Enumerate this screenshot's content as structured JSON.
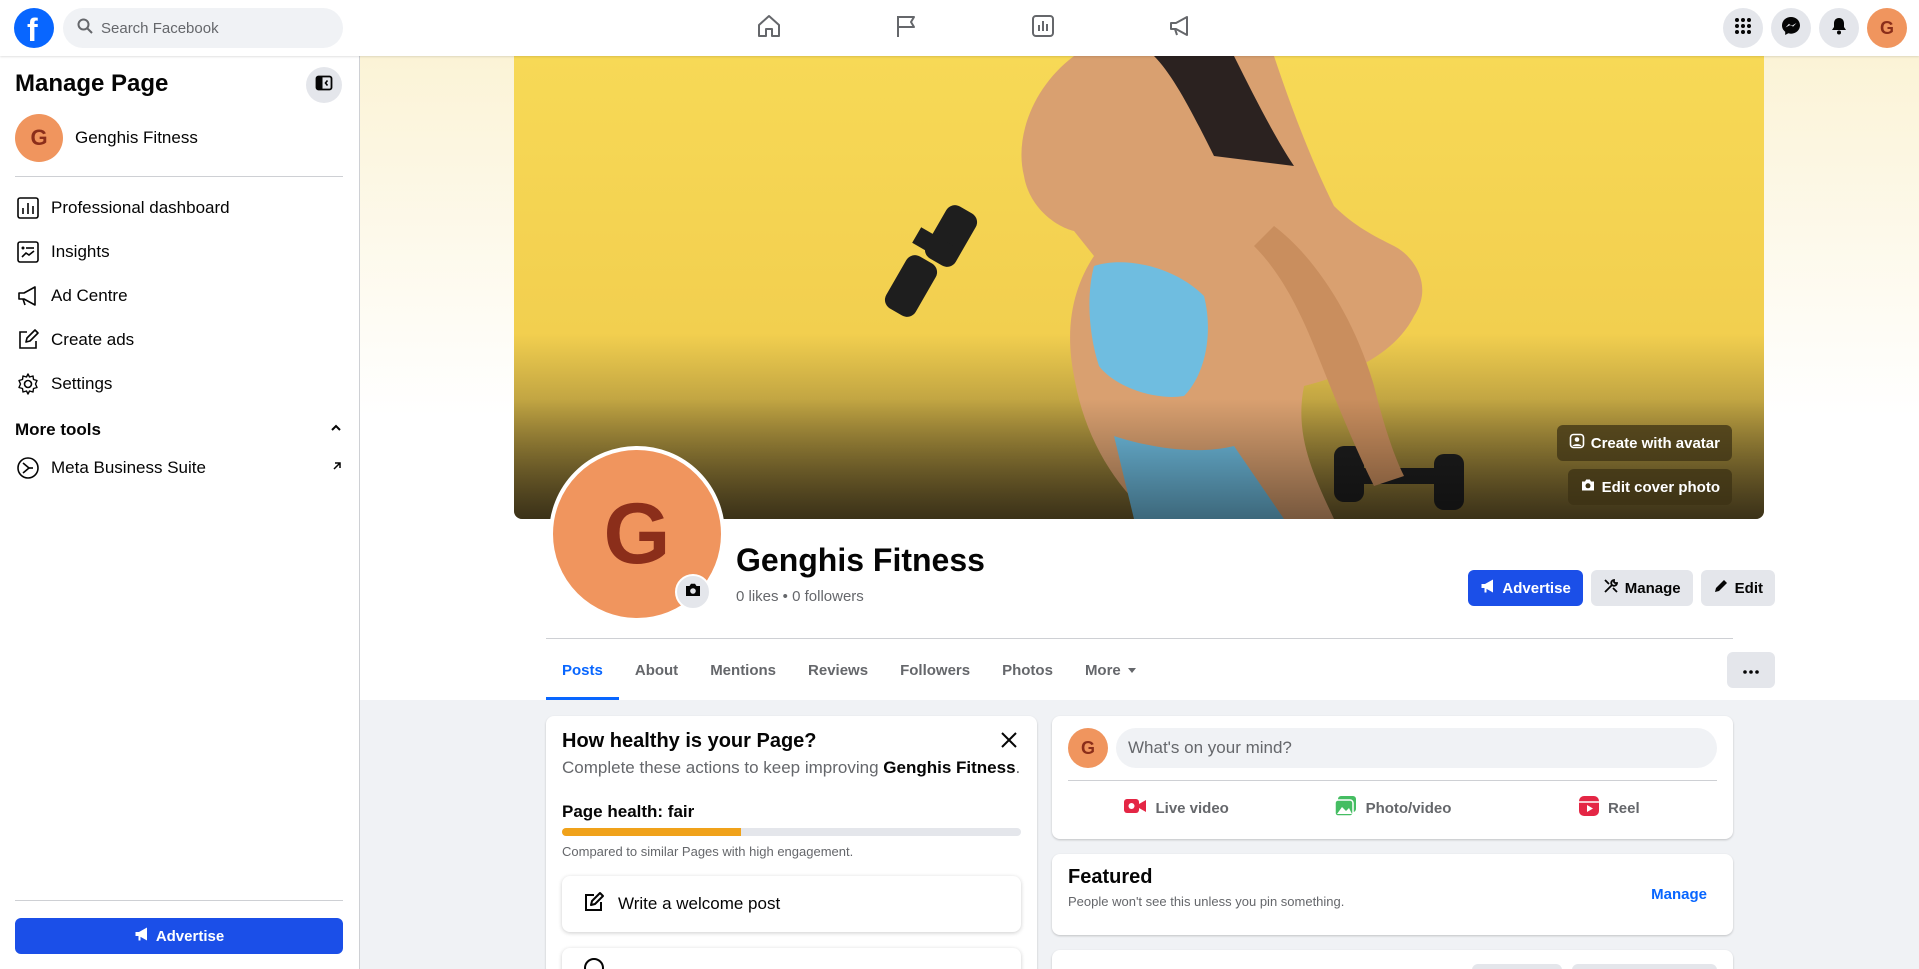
{
  "topbar": {
    "search_placeholder": "Search Facebook",
    "nav_icons": [
      "home-icon",
      "flag-icon",
      "insights-icon",
      "megaphone-icon"
    ],
    "right_icons": [
      "menu-grid-icon",
      "messenger-icon",
      "notifications-icon"
    ],
    "account_initial": "G"
  },
  "sidebar": {
    "title": "Manage Page",
    "page_initial": "G",
    "page_name": "Genghis Fitness",
    "items": [
      {
        "label": "Professional dashboard",
        "icon": "dashboard-icon"
      },
      {
        "label": "Insights",
        "icon": "insights-icon"
      },
      {
        "label": "Ad Centre",
        "icon": "megaphone-icon"
      },
      {
        "label": "Create ads",
        "icon": "edit-icon"
      },
      {
        "label": "Settings",
        "icon": "gear-icon"
      }
    ],
    "more_tools_label": "More tools",
    "meta_suite_label": "Meta Business Suite",
    "advertise_label": "Advertise"
  },
  "cover": {
    "create_avatar_label": "Create with avatar",
    "edit_cover_label": "Edit cover photo"
  },
  "profile": {
    "initial": "G",
    "name": "Genghis Fitness",
    "stats": "0 likes • 0 followers",
    "actions": {
      "advertise": "Advertise",
      "manage": "Manage",
      "edit": "Edit"
    }
  },
  "tabs": [
    {
      "label": "Posts",
      "active": true
    },
    {
      "label": "About",
      "active": false
    },
    {
      "label": "Mentions",
      "active": false
    },
    {
      "label": "Reviews",
      "active": false
    },
    {
      "label": "Followers",
      "active": false
    },
    {
      "label": "Photos",
      "active": false
    },
    {
      "label": "More",
      "active": false
    }
  ],
  "health": {
    "title": "How healthy is your Page?",
    "subtitle_prefix": "Complete these actions to keep improving",
    "subtitle_page": "Genghis Fitness",
    "subtitle_suffix": ".",
    "label": "Page health: fair",
    "progress": 0.39,
    "comparison": "Compared to similar Pages with high engagement.",
    "task_welcome": "Write a welcome post"
  },
  "composer": {
    "initial": "G",
    "placeholder": "What's on your mind?",
    "actions": {
      "live": "Live video",
      "photo": "Photo/video",
      "reel": "Reel"
    }
  },
  "featured": {
    "title": "Featured",
    "subtitle": "People won't see this unless you pin something.",
    "manage_label": "Manage"
  },
  "colors": {
    "brand_blue": "#0866ff",
    "button_blue": "#1b4fe8",
    "avatar_orange": "#f0955e",
    "health_orange": "#f0a21a",
    "cover_yellow": "#f2cf4f"
  }
}
